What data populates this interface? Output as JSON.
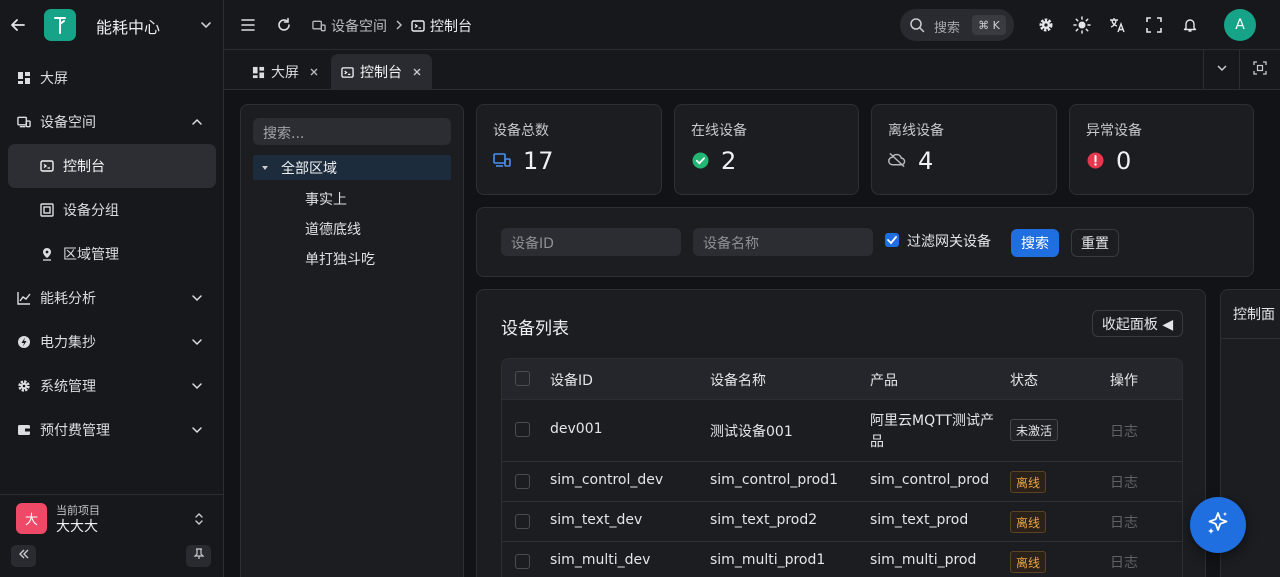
{
  "sidebar": {
    "app_name": "能耗中心",
    "menu": {
      "dashboard": "大屏",
      "device_space": "设备空间",
      "console": "控制台",
      "device_group": "设备分组",
      "region_mgmt": "区域管理",
      "energy_analysis": "能耗分析",
      "power_collect": "电力集抄",
      "system_mgmt": "系统管理",
      "prepaid_mgmt": "预付费管理"
    },
    "project": {
      "caption": "当前项目",
      "avatar_text": "大",
      "name": "大大大"
    }
  },
  "header": {
    "breadcrumb": [
      "设备空间",
      "控制台"
    ],
    "search_placeholder": "搜索",
    "shortcut": "⌘ K",
    "user_initial": "A"
  },
  "tabs": [
    {
      "label": "大屏"
    },
    {
      "label": "控制台"
    }
  ],
  "tree": {
    "search_placeholder": "搜索...",
    "root": "全部区域",
    "children": [
      "事实上",
      "道德底线",
      "单打独斗吃"
    ]
  },
  "stats": [
    {
      "label": "设备总数",
      "value": "17"
    },
    {
      "label": "在线设备",
      "value": "2"
    },
    {
      "label": "离线设备",
      "value": "4"
    },
    {
      "label": "异常设备",
      "value": "0"
    }
  ],
  "filters": {
    "device_id_placeholder": "设备ID",
    "device_name_placeholder": "设备名称",
    "gateway_filter_label": "过滤网关设备",
    "search_button": "搜索",
    "reset_button": "重置"
  },
  "device_list": {
    "title": "设备列表",
    "collapse_button": "收起面板 ◀",
    "columns": [
      "设备ID",
      "设备名称",
      "产品",
      "状态",
      "操作"
    ],
    "rows": [
      {
        "id": "dev001",
        "name": "测试设备001",
        "product_line1": "阿里云MQTT测试产",
        "product_line2": "品",
        "status": "未激活",
        "action": "日志"
      },
      {
        "id": "sim_control_dev",
        "name": "sim_control_prod1",
        "product": "sim_control_prod",
        "status": "离线",
        "action": "日志"
      },
      {
        "id": "sim_text_dev",
        "name": "sim_text_prod2",
        "product": "sim_text_prod",
        "status": "离线",
        "action": "日志"
      },
      {
        "id": "sim_multi_dev",
        "name": "sim_multi_prod1",
        "product": "sim_multi_prod",
        "status": "离线",
        "action": "日志"
      }
    ]
  },
  "control_panel": {
    "tab_label": "控制面"
  },
  "colors": {
    "brand": "#16a387",
    "primary": "#1f6fe0",
    "online": "#22b573",
    "error": "#e5374e",
    "offline_tag": "#e9a445"
  }
}
